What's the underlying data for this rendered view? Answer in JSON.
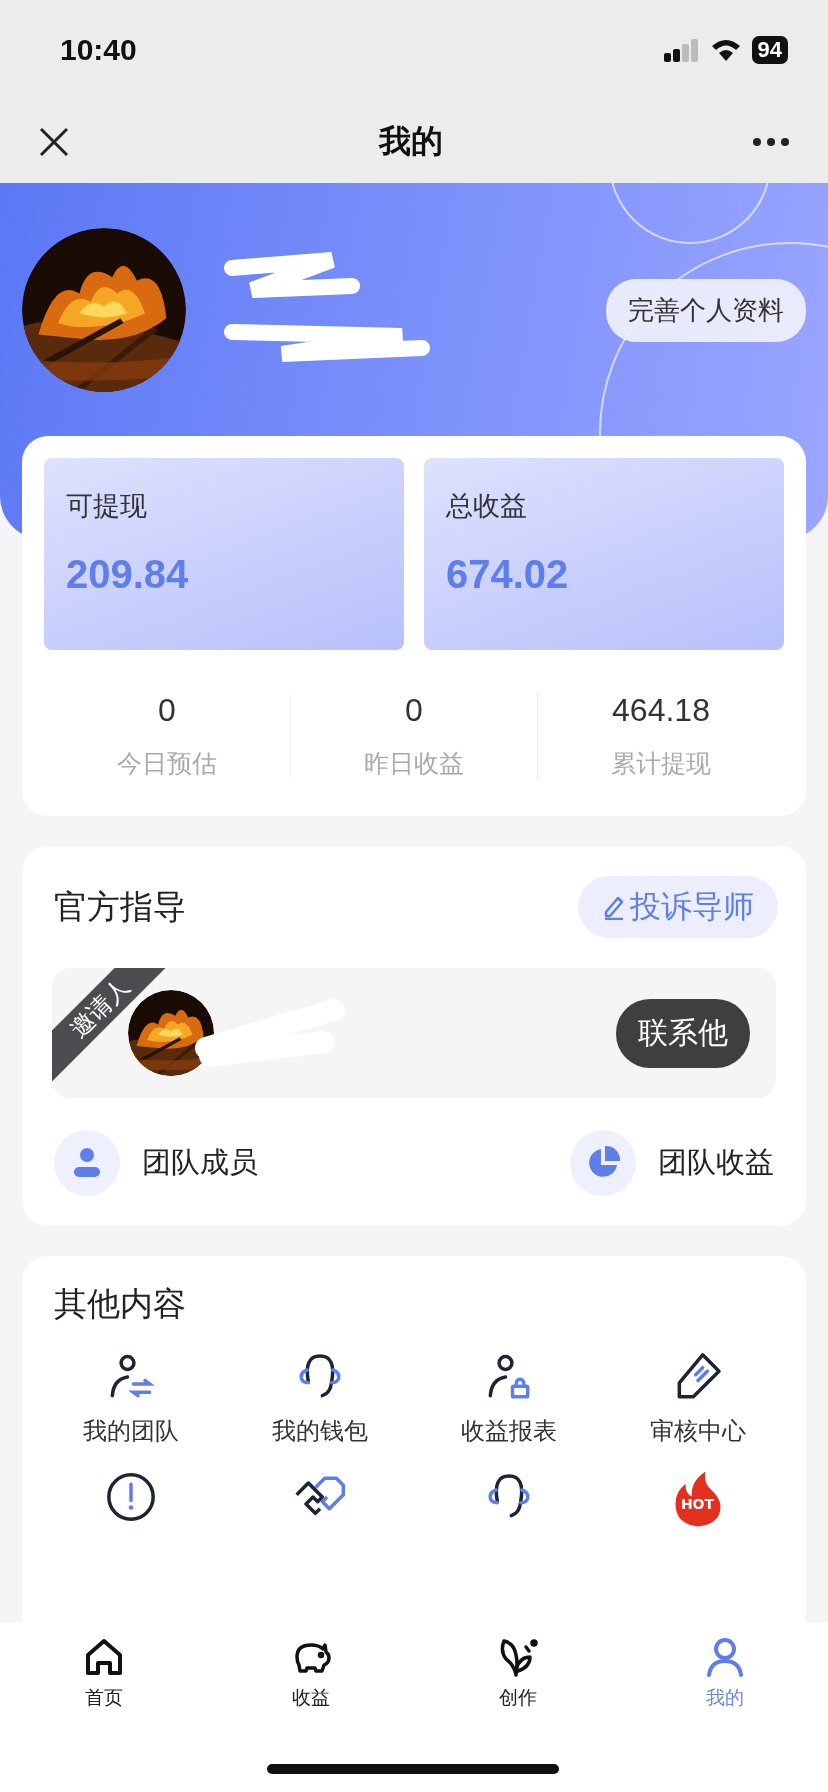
{
  "status_bar": {
    "time": "10:40",
    "battery": "94"
  },
  "nav_bar": {
    "title": "我的"
  },
  "profile": {
    "edit_button": "完善个人资料"
  },
  "earnings": {
    "cards": [
      {
        "label": "可提现",
        "value": "209.84"
      },
      {
        "label": "总收益",
        "value": "674.02"
      }
    ],
    "stats": [
      {
        "value": "0",
        "label": "今日预估"
      },
      {
        "value": "0",
        "label": "昨日收益"
      },
      {
        "value": "464.18",
        "label": "累计提现"
      }
    ]
  },
  "guide": {
    "title": "官方指导",
    "complain_button": "投诉导师",
    "inviter": {
      "ribbon": "邀请人",
      "contact_button": "联系他"
    },
    "links": [
      {
        "label": "团队成员"
      },
      {
        "label": "团队收益"
      }
    ]
  },
  "other": {
    "title": "其他内容",
    "items": [
      {
        "label": "我的团队"
      },
      {
        "label": "我的钱包"
      },
      {
        "label": "收益报表"
      },
      {
        "label": "审核中心"
      }
    ],
    "hot_badge": "HOT"
  },
  "tab_bar": {
    "tabs": [
      {
        "label": "首页",
        "selected": false
      },
      {
        "label": "收益",
        "selected": false
      },
      {
        "label": "创作",
        "selected": false
      },
      {
        "label": "我的",
        "selected": true
      }
    ]
  }
}
